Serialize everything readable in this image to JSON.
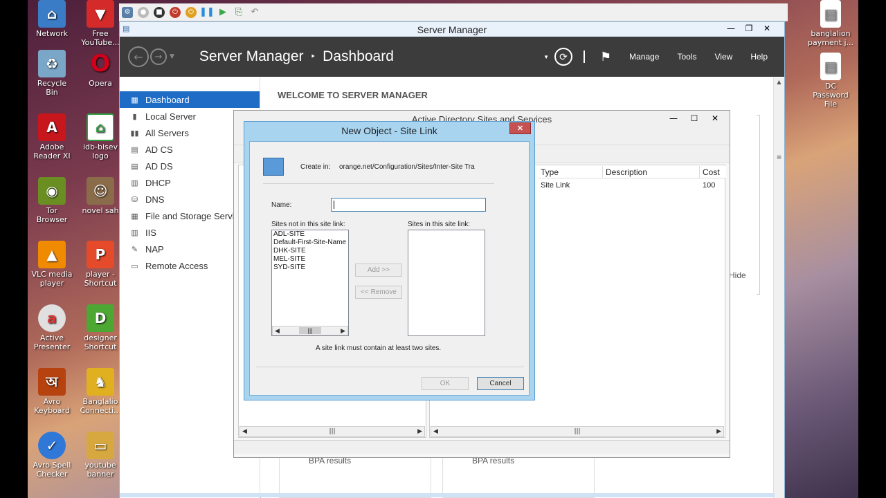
{
  "desktop": {
    "left_icons": [
      {
        "label": "Network",
        "icon": "network-icon",
        "color": "#3a7cc6"
      },
      {
        "label": "Recycle Bin",
        "icon": "recycle-bin-icon",
        "color": "#7aa6c8"
      },
      {
        "label": "Adobe Reader XI",
        "icon": "adobe-reader-icon",
        "color": "#c8161d"
      },
      {
        "label": "Tor Browser",
        "icon": "tor-browser-icon",
        "color": "#6b8e23"
      },
      {
        "label": "VLC media player",
        "icon": "vlc-icon",
        "color": "#f08a00"
      },
      {
        "label": "Active Presenter",
        "icon": "active-presenter-icon",
        "color": "#e0e0e0"
      },
      {
        "label": "Avro Keyboard",
        "icon": "avro-keyboard-icon",
        "color": "#b5420f"
      },
      {
        "label": "Avro Spell Checker",
        "icon": "avro-spell-icon",
        "color": "#2f78d8"
      }
    ],
    "second_column_icons": [
      {
        "label": "Free YouTube...",
        "icon": "youtube-icon",
        "color": "#d42a2a"
      },
      {
        "label": "Opera",
        "icon": "opera-icon",
        "color": "#d0021b"
      },
      {
        "label": "idb-bisev logo",
        "icon": "idb-logo-icon",
        "color": "#2e9e3e"
      },
      {
        "label": "novel sah",
        "icon": "photo-icon",
        "color": "#8a6b4a"
      },
      {
        "label": "player - Shortcut",
        "icon": "player-icon",
        "color": "#e54b2a"
      },
      {
        "label": "designer Shortcut",
        "icon": "designer-icon",
        "color": "#4ca733"
      },
      {
        "label": "Banglalio Connecti...",
        "icon": "banglalion-icon",
        "color": "#e0b020"
      },
      {
        "label": "youtube banner",
        "icon": "folder-icon",
        "color": "#d8a840"
      }
    ],
    "right_icons": [
      {
        "label": "banglalion payment j...",
        "icon": "document-icon"
      },
      {
        "label": "DC Password File",
        "icon": "document-icon"
      }
    ]
  },
  "server_manager": {
    "window_title": "Server Manager",
    "breadcrumb_root": "Server Manager",
    "breadcrumb_sep": "‣",
    "breadcrumb_page": "Dashboard",
    "menu": {
      "manage": "Manage",
      "tools": "Tools",
      "view": "View",
      "help": "Help"
    },
    "sidebar": [
      {
        "label": "Dashboard",
        "icon": "dashboard-icon",
        "active": true
      },
      {
        "label": "Local Server",
        "icon": "local-server-icon",
        "active": false
      },
      {
        "label": "All Servers",
        "icon": "all-servers-icon",
        "active": false
      },
      {
        "label": "AD CS",
        "icon": "ad-cs-icon",
        "active": false
      },
      {
        "label": "AD DS",
        "icon": "ad-ds-icon",
        "active": false
      },
      {
        "label": "DHCP",
        "icon": "dhcp-icon",
        "active": false
      },
      {
        "label": "DNS",
        "icon": "dns-icon",
        "active": false
      },
      {
        "label": "File and Storage Servi",
        "icon": "storage-icon",
        "active": false
      },
      {
        "label": "IIS",
        "icon": "iis-icon",
        "active": false
      },
      {
        "label": "NAP",
        "icon": "nap-icon",
        "active": false
      },
      {
        "label": "Remote Access",
        "icon": "remote-access-icon",
        "active": false
      }
    ],
    "welcome": "WELCOME TO SERVER MANAGER",
    "bpa_left": "BPA results",
    "bpa_right": "BPA results",
    "hide": "Hide",
    "accent": "#1e6cc5"
  },
  "adss": {
    "title": "Active Directory Sites and Services",
    "columns": [
      "Type",
      "Description",
      "Cost"
    ],
    "row": {
      "type": "Site Link",
      "description": "",
      "cost": "100"
    }
  },
  "dialog": {
    "title": "New Object - Site Link",
    "create_in_label": "Create in:",
    "create_in_path": "orange.net/Configuration/Sites/Inter-Site Tra",
    "name_label": "Name:",
    "name_value": "",
    "sites_not_label": "Sites not in this site link:",
    "sites_in_label": "Sites in this site link:",
    "sites_not": [
      "ADL-SITE",
      "Default-First-Site-Name",
      "DHK-SITE",
      "MEL-SITE",
      "SYD-SITE"
    ],
    "sites_in": [],
    "add_btn": "Add >>",
    "remove_btn": "<< Remove",
    "hint": "A site link must contain at least two sites.",
    "ok_btn": "OK",
    "cancel_btn": "Cancel"
  }
}
